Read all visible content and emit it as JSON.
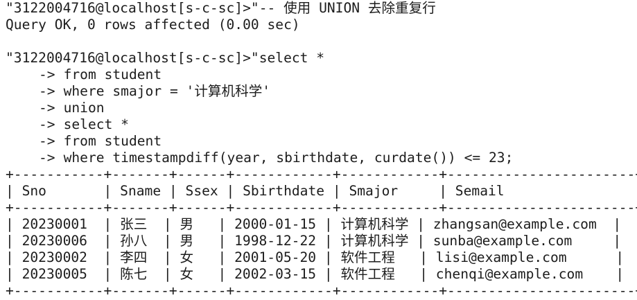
{
  "session": {
    "comment_block": {
      "prompt": "\"3122004716@localhost[s-c-sc]>\"",
      "command": "-- 使用 UNION 去除重复行",
      "result": "Query OK, 0 rows affected (0.00 sec)"
    },
    "query_block": {
      "prompt": "\"3122004716@localhost[s-c-sc]>\"",
      "first_line": "select *",
      "continuation_marker": "->",
      "continuation_lines": [
        "from student",
        "where smajor = '计算机科学'",
        "union",
        "select *",
        "from student",
        "where timestampdiff(year, sbirthdate, curdate()) <= 23;"
      ]
    }
  },
  "table": {
    "border": "+-----------+-------+------+------------+------------+-----------------------+",
    "header": "| Sno       | Sname | Ssex | Sbirthdate | Smajor     | Semail                |",
    "columns": [
      "Sno",
      "Sname",
      "Ssex",
      "Sbirthdate",
      "Smajor",
      "Semail"
    ],
    "row_lines": [
      "| 20230001  | 张三  | 男   | 2000-01-15 | 计算机科学 | zhangsan@example.com  |",
      "| 20230006  | 孙八  | 男   | 1998-12-22 | 计算机科学 | sunba@example.com     |",
      "| 20230002  | 李四  | 女   | 2001-05-20 | 软件工程   | lisi@example.com      |",
      "| 20230005  | 陈七  | 女   | 2002-03-15 | 软件工程   | chenqi@example.com    |"
    ],
    "rows": [
      [
        "20230001",
        "张三",
        "男",
        "2000-01-15",
        "计算机科学",
        "zhangsan@example.com"
      ],
      [
        "20230006",
        "孙八",
        "男",
        "1998-12-22",
        "计算机科学",
        "sunba@example.com"
      ],
      [
        "20230002",
        "李四",
        "女",
        "2001-05-20",
        "软件工程",
        "lisi@example.com"
      ],
      [
        "20230005",
        "陈七",
        "女",
        "2002-03-15",
        "软件工程",
        "chenqi@example.com"
      ]
    ]
  }
}
